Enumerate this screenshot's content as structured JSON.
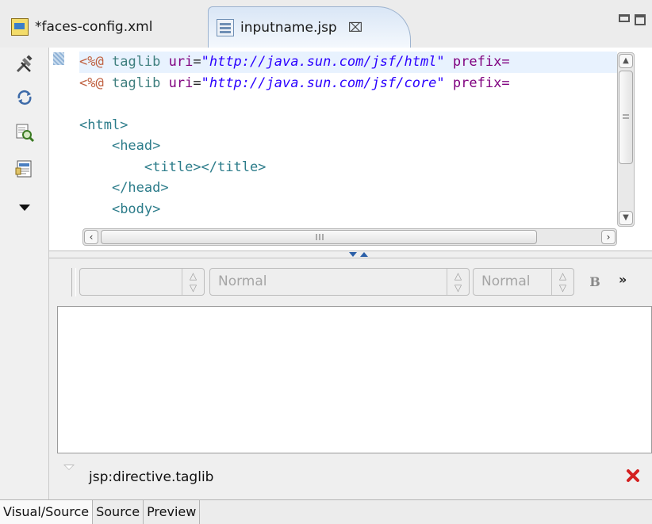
{
  "tabs": [
    {
      "label": "*faces-config.xml",
      "icon": "xml-file-icon"
    },
    {
      "label": "inputname.jsp",
      "icon": "jsp-file-icon",
      "active": true,
      "close_icon": "close-icon"
    }
  ],
  "palette": {
    "items": [
      "tools-icon",
      "refresh-icon",
      "page-search-icon",
      "template-icon"
    ],
    "menu_icon": "dropdown-arrow-icon"
  },
  "editor": {
    "line1": {
      "directive": "<%@",
      "keyword": "taglib",
      "attr": "uri",
      "eq": "=",
      "value": "\"http://java.sun.com/jsf/html\"",
      "attr2": "prefix="
    },
    "line2": {
      "directive": "<%@",
      "keyword": "taglib",
      "attr": "uri",
      "eq": "=",
      "value": "\"http://java.sun.com/jsf/core\"",
      "attr2": "prefix="
    },
    "line3": "",
    "line4": "<html>",
    "line5": "<head>",
    "line6": "<title></title>",
    "line7": "</head>",
    "line8": "<body>",
    "hscroll_grip": "III"
  },
  "toolbar": {
    "style_value": "",
    "format_value": "Normal",
    "size_value": "Normal",
    "bold_label": "B",
    "more_label": "»"
  },
  "selection": {
    "path": "jsp:directive.taglib",
    "remove_icon": "red-x-icon"
  },
  "bottom_tabs": [
    "Visual/Source",
    "Source",
    "Preview"
  ],
  "colors": {
    "directive": "#bf5f3f",
    "keyword": "#3f7f7f",
    "attribute": "#7f007f",
    "string": "#2a00ff",
    "tag": "#2c7c8a",
    "current_line": "#e8f2fe"
  }
}
